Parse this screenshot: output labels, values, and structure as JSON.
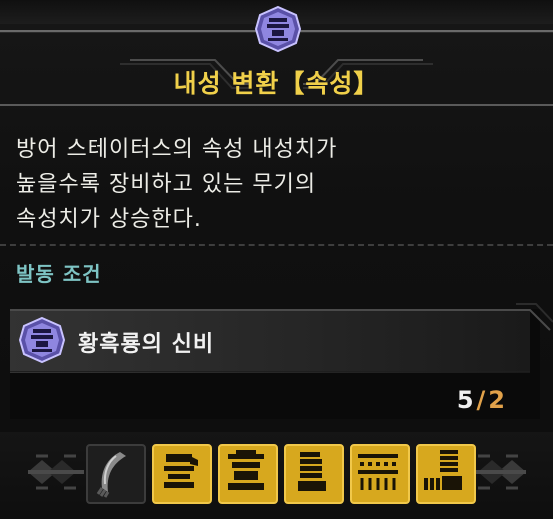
{
  "skill": {
    "title": "내성 변환【속성】",
    "description_lines": [
      "방어 스테이터스의 속성 내성치가",
      "높을수록 장비하고 있는 무기의",
      "속성치가 상승한다."
    ],
    "activation_label": "발동 조건",
    "icon": "armor-set-emblem-icon",
    "icon_color": "#8f86e0"
  },
  "set_bonus": {
    "name": "황흑룡의 신비",
    "icon": "armor-set-emblem-icon",
    "equipped_count": "5",
    "separator": "/",
    "required_count": "2"
  },
  "equipment_slots": [
    {
      "name": "weapon-slot",
      "icon": "longsword-icon",
      "state": "not-matching"
    },
    {
      "name": "helm-slot",
      "icon": "helmet-icon",
      "state": "matching"
    },
    {
      "name": "chest-slot",
      "icon": "chest-armor-icon",
      "state": "matching"
    },
    {
      "name": "arms-slot",
      "icon": "gauntlet-icon",
      "state": "matching"
    },
    {
      "name": "waist-slot",
      "icon": "waist-armor-icon",
      "state": "matching"
    },
    {
      "name": "legs-slot",
      "icon": "leg-armor-icon",
      "state": "matching"
    }
  ],
  "colors": {
    "title": "#f0d04a",
    "activation": "#7ec4c4",
    "count_required": "#e2a24a",
    "slot_active": "#d7a81e",
    "slot_inactive": "#202020"
  }
}
